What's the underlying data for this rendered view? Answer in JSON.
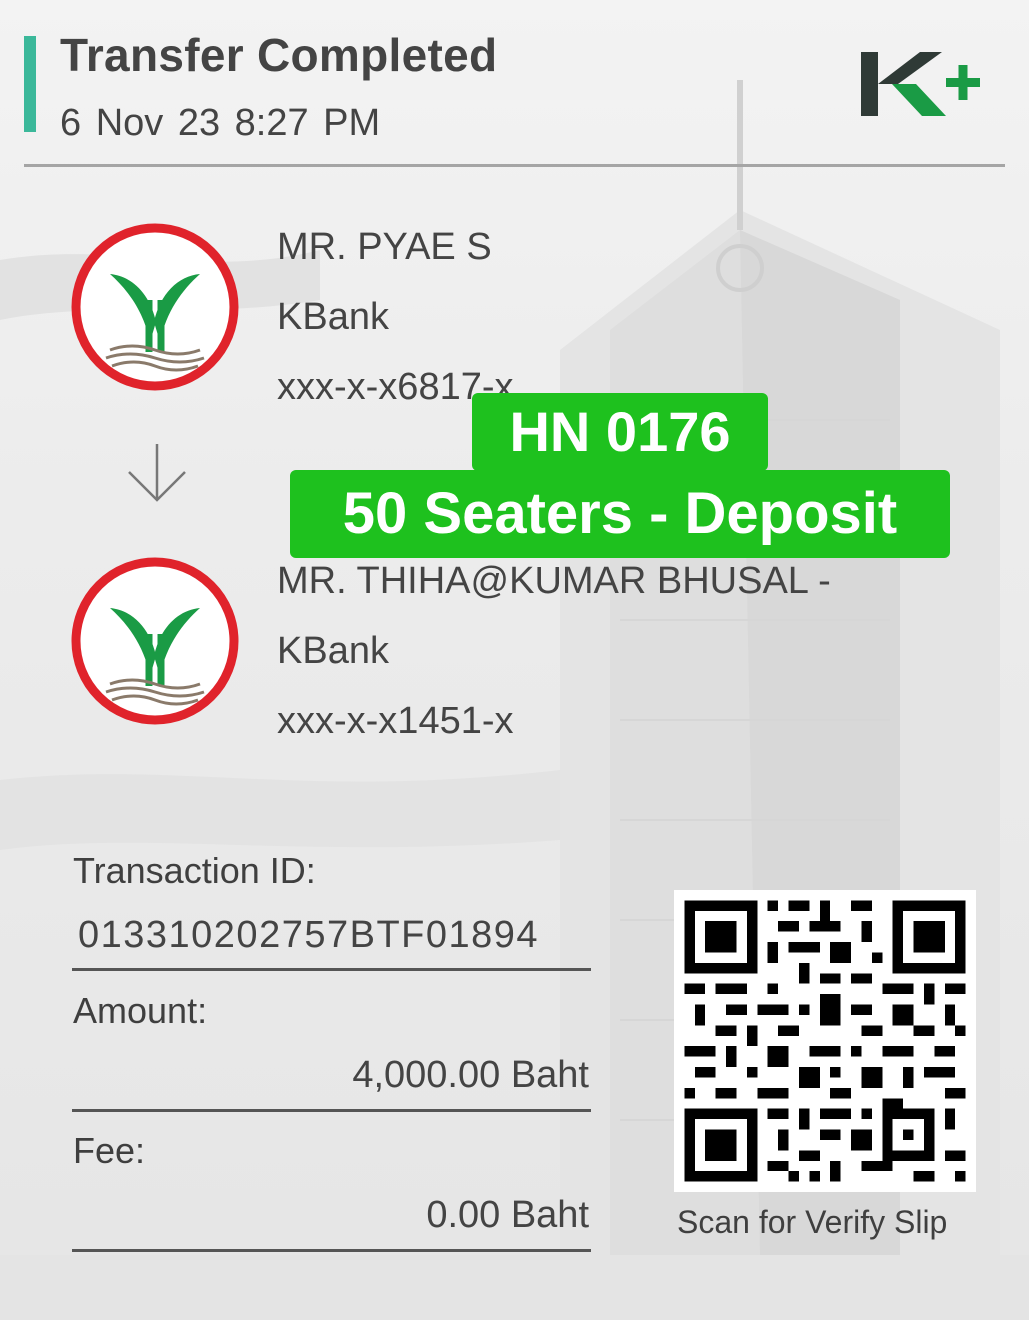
{
  "header": {
    "title": "Transfer Completed",
    "datetime": "6 Nov 23  8:27 PM",
    "logo_text": "K+"
  },
  "sender": {
    "name": "MR. PYAE S",
    "bank": "KBank",
    "account": "xxx-x-x6817-x",
    "logo_icon": "kbank-logo"
  },
  "receiver": {
    "name": "MR. THIHA@KUMAR BHUSAL -",
    "bank": "KBank",
    "account": "xxx-x-x1451-x",
    "logo_icon": "kbank-logo"
  },
  "arrow_icon": "arrow-down-icon",
  "details": {
    "transaction_id_label": "Transaction ID:",
    "transaction_id": "013310202757BTF01894",
    "amount_label": "Amount:",
    "amount": "4,000.00 Baht",
    "fee_label": "Fee:",
    "fee": "0.00 Baht"
  },
  "qr": {
    "caption": "Scan for Verify Slip"
  },
  "overlay": {
    "line1": "HN 0176",
    "line2": "50 Seaters - Deposit"
  },
  "colors": {
    "accent": "#3bb89a",
    "kbank_green": "#1a9b45",
    "kbank_red": "#e0232b",
    "overlay_green": "#1ec11e",
    "kplus_dark": "#2f3a36"
  }
}
